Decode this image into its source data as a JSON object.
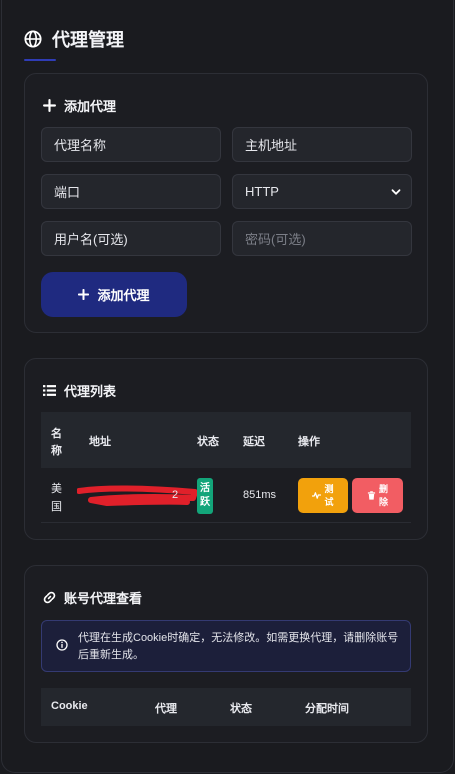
{
  "page": {
    "title": "代理管理"
  },
  "add_proxy": {
    "title": "添加代理",
    "name_placeholder": "代理名称",
    "host_placeholder": "主机地址",
    "port_placeholder": "端口",
    "protocol_selected": "HTTP",
    "username_placeholder": "用户名(可选)",
    "password_placeholder": "密码(可选)",
    "submit_label": "添加代理"
  },
  "proxy_list": {
    "title": "代理列表",
    "columns": [
      "名称",
      "地址",
      "状态",
      "延迟",
      "操作"
    ],
    "name_col_line1": "名",
    "name_col_line2": "称",
    "rows": [
      {
        "name_line1": "美",
        "name_line2": "国",
        "address_suffix": "2",
        "status_line1": "活",
        "status_line2": "跃",
        "latency": "851ms",
        "test_line1": "测",
        "test_line2": "试",
        "delete_line1": "删",
        "delete_line2": "除"
      }
    ]
  },
  "account_proxy": {
    "title": "账号代理查看",
    "info_text": "代理在生成Cookie时确定，无法修改。如需更换代理，请删除账号后重新生成。",
    "columns": [
      "Cookie",
      "代理",
      "状态",
      "分配时间"
    ]
  },
  "colors": {
    "accent": "#1f2a80",
    "active_badge": "#13a57a",
    "test_button": "#f2a10c",
    "delete_button": "#f25d63",
    "redaction": "#e0202a"
  }
}
